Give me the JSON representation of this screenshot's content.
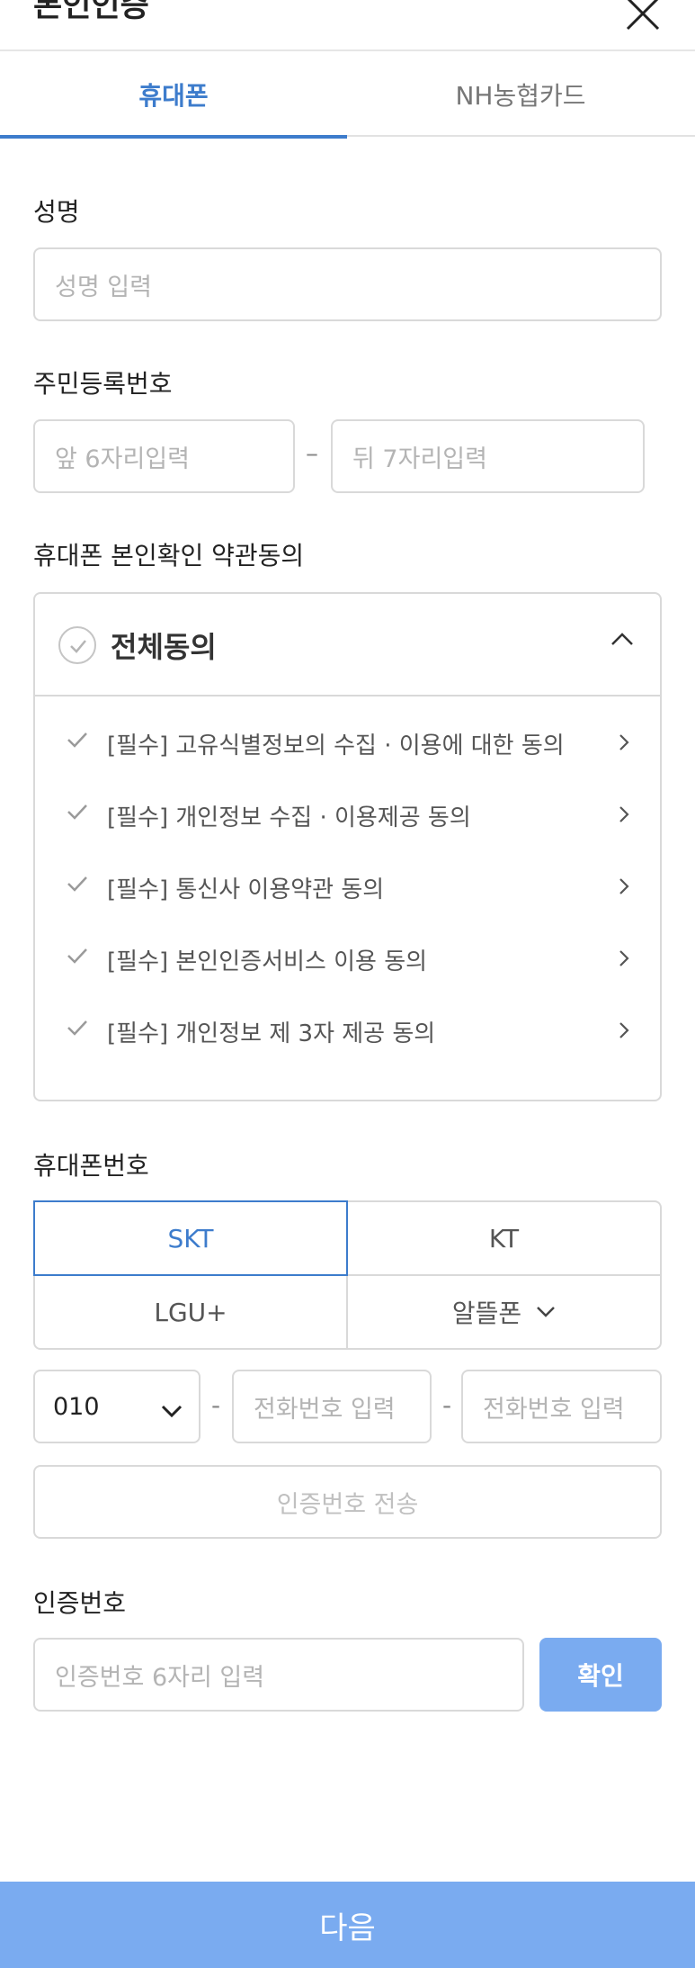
{
  "header": {
    "title": "본인인증",
    "close_icon": "close-icon"
  },
  "tabs": [
    {
      "label": "휴대폰",
      "active": true
    },
    {
      "label": "NH농협카드",
      "active": false
    }
  ],
  "name": {
    "label": "성명",
    "placeholder": "성명 입력"
  },
  "resident": {
    "label": "주민등록번호",
    "front_placeholder": "앞 6자리입력",
    "back_placeholder": "뒤 7자리입력",
    "separator": "–"
  },
  "terms": {
    "label": "휴대폰 본인확인 약관동의",
    "agree_all": "전체동의",
    "items": [
      {
        "label": "[필수] 고유식별정보의 수집 · 이용에 대한 동의"
      },
      {
        "label": "[필수] 개인정보 수집 · 이용제공 동의"
      },
      {
        "label": "[필수] 통신사 이용약관 동의"
      },
      {
        "label": "[필수] 본인인증서비스 이용 동의"
      },
      {
        "label": "[필수] 개인정보 제 3자 제공 동의"
      }
    ]
  },
  "phone": {
    "label": "휴대폰번호",
    "carriers": [
      {
        "label": "SKT",
        "selected": true
      },
      {
        "label": "KT",
        "selected": false
      },
      {
        "label": "LGU+",
        "selected": false
      },
      {
        "label": "알뜰폰",
        "selected": false
      }
    ],
    "prefix": "010",
    "separator": "-",
    "middle_placeholder": "전화번호 입력",
    "last_placeholder": "전화번호 입력",
    "send_button": "인증번호 전송"
  },
  "verify": {
    "label": "인증번호",
    "placeholder": "인증번호 6자리 입력",
    "confirm_button": "확인"
  },
  "footer": {
    "next_button": "다음"
  },
  "colors": {
    "accent": "#3d7ccc",
    "button_fill": "#7aabf0",
    "border": "#d9d9d9",
    "placeholder": "#b4b4b4"
  }
}
